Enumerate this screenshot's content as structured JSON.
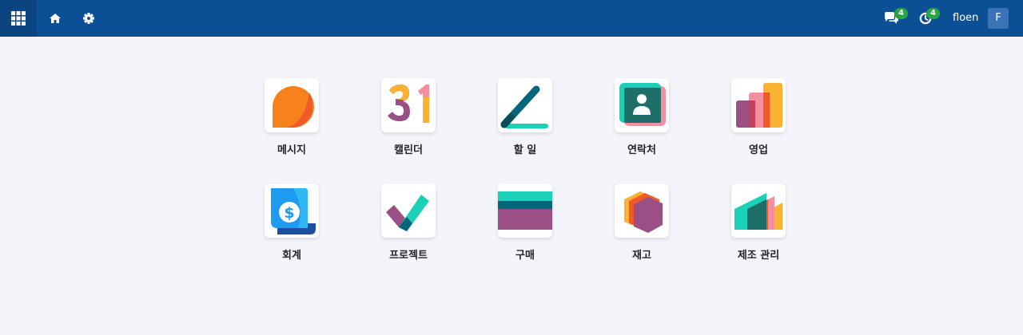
{
  "navbar": {
    "user_name": "floen",
    "avatar_initial": "F",
    "messages_count": "4",
    "activities_count": "4"
  },
  "apps": [
    {
      "label": "메시지",
      "icon": "discuss-icon"
    },
    {
      "label": "캘린더",
      "icon": "calendar-icon"
    },
    {
      "label": "할 일",
      "icon": "todo-icon"
    },
    {
      "label": "연락처",
      "icon": "contacts-icon"
    },
    {
      "label": "영업",
      "icon": "sales-icon"
    },
    {
      "label": "회계",
      "icon": "accounting-icon"
    },
    {
      "label": "프로젝트",
      "icon": "project-icon"
    },
    {
      "label": "구매",
      "icon": "purchase-icon"
    },
    {
      "label": "재고",
      "icon": "inventory-icon"
    },
    {
      "label": "제조 관리",
      "icon": "manufacturing-icon"
    }
  ],
  "colors": {
    "navbar": "#0b4f94",
    "background": "#f4f5fb",
    "badge": "#28a745"
  }
}
